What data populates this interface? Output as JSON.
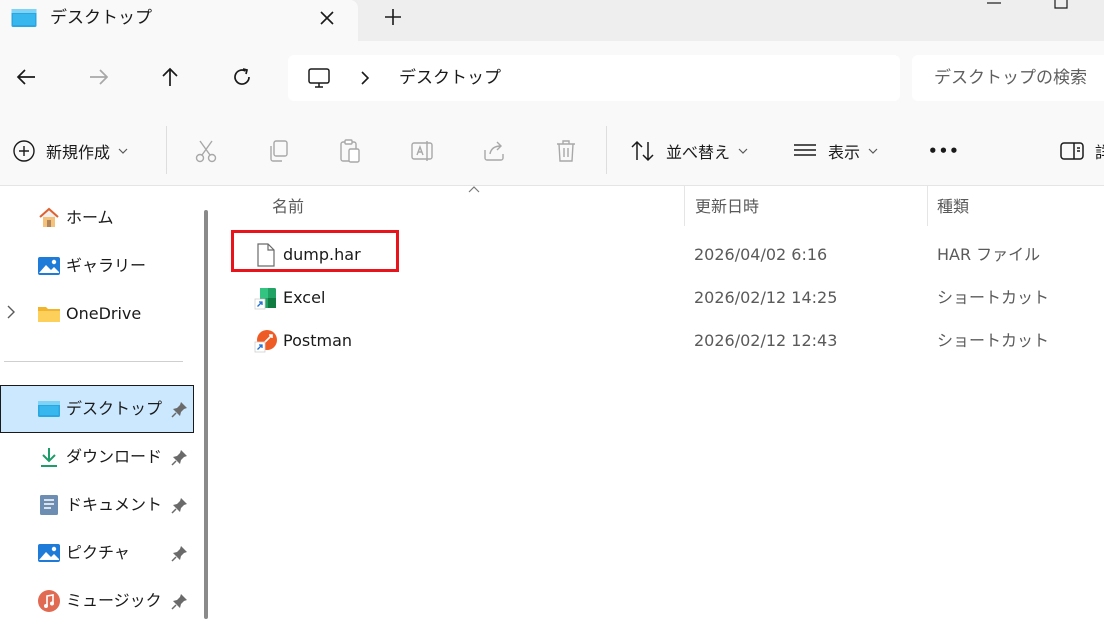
{
  "window": {
    "tab_title": "デスクトップ",
    "new_tab": "+"
  },
  "address": {
    "breadcrumb": "デスクトップ",
    "search_placeholder": "デスクトップの検索"
  },
  "toolbar": {
    "new_label": "新規作成",
    "sort_label": "並べ替え",
    "view_label": "表示",
    "more_label": "•••",
    "details_label": "詳"
  },
  "sidebar": {
    "items": [
      {
        "label": "ホーム",
        "icon": "home-icon"
      },
      {
        "label": "ギャラリー",
        "icon": "gallery-icon"
      },
      {
        "label": "OneDrive",
        "icon": "folder-icon"
      },
      {
        "label": "デスクトップ",
        "icon": "desktop-icon",
        "selected": true,
        "pinned": true
      },
      {
        "label": "ダウンロード",
        "icon": "download-icon",
        "pinned": true
      },
      {
        "label": "ドキュメント",
        "icon": "document-icon",
        "pinned": true
      },
      {
        "label": "ピクチャ",
        "icon": "pictures-icon",
        "pinned": true
      },
      {
        "label": "ミュージック",
        "icon": "music-icon",
        "pinned": true
      }
    ]
  },
  "columns": {
    "name": "名前",
    "date": "更新日時",
    "type": "種類"
  },
  "files": [
    {
      "name": "dump.har",
      "date": "2026/04/02 6:16",
      "type": "HAR ファイル",
      "icon": "file-icon"
    },
    {
      "name": "Excel",
      "date": "2026/02/12 14:25",
      "type": "ショートカット",
      "icon": "excel-shortcut-icon"
    },
    {
      "name": "Postman",
      "date": "2026/02/12 12:43",
      "type": "ショートカット",
      "icon": "postman-shortcut-icon"
    }
  ],
  "colors": {
    "accent_selected": "#cce8ff",
    "highlight_box": "#e8131b"
  }
}
